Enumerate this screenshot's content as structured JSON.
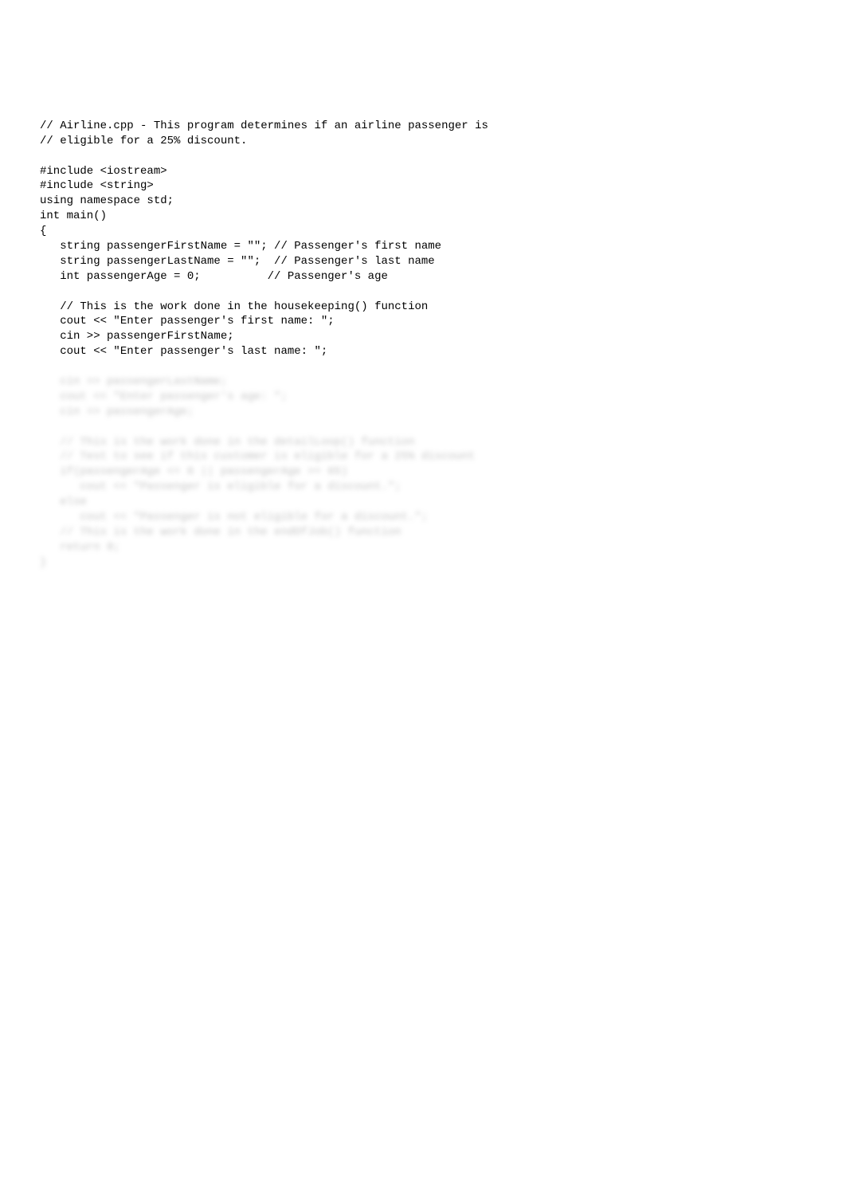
{
  "lines": [
    "// Airline.cpp - This program determines if an airline passenger is",
    "// eligible for a 25% discount.",
    "",
    "#include <iostream>",
    "#include <string>",
    "using namespace std;",
    "int main()",
    "{",
    "   string passengerFirstName = \"\"; // Passenger's first name",
    "   string passengerLastName = \"\";  // Passenger's last name",
    "   int passengerAge = 0;          // Passenger's age",
    "",
    "   // This is the work done in the housekeeping() function",
    "   cout << \"Enter passenger's first name: \";",
    "   cin >> passengerFirstName;",
    "   cout << \"Enter passenger's last name: \";"
  ],
  "blurred_lines": [
    "   cin >> passengerLastName;",
    "   cout << \"Enter passenger's age: \";",
    "   cin >> passengerAge;",
    "",
    "   // This is the work done in the detailLoop() function",
    "   // Test to see if this customer is eligible for a 25% discount",
    "   if(passengerAge <= 6 || passengerAge >= 65)",
    "      cout << \"Passenger is eligible for a discount.\";",
    "   else",
    "      cout << \"Passenger is not eligible for a discount.\";",
    "   // This is the work done in the endOfJob() function",
    "   return 0;",
    "}"
  ]
}
